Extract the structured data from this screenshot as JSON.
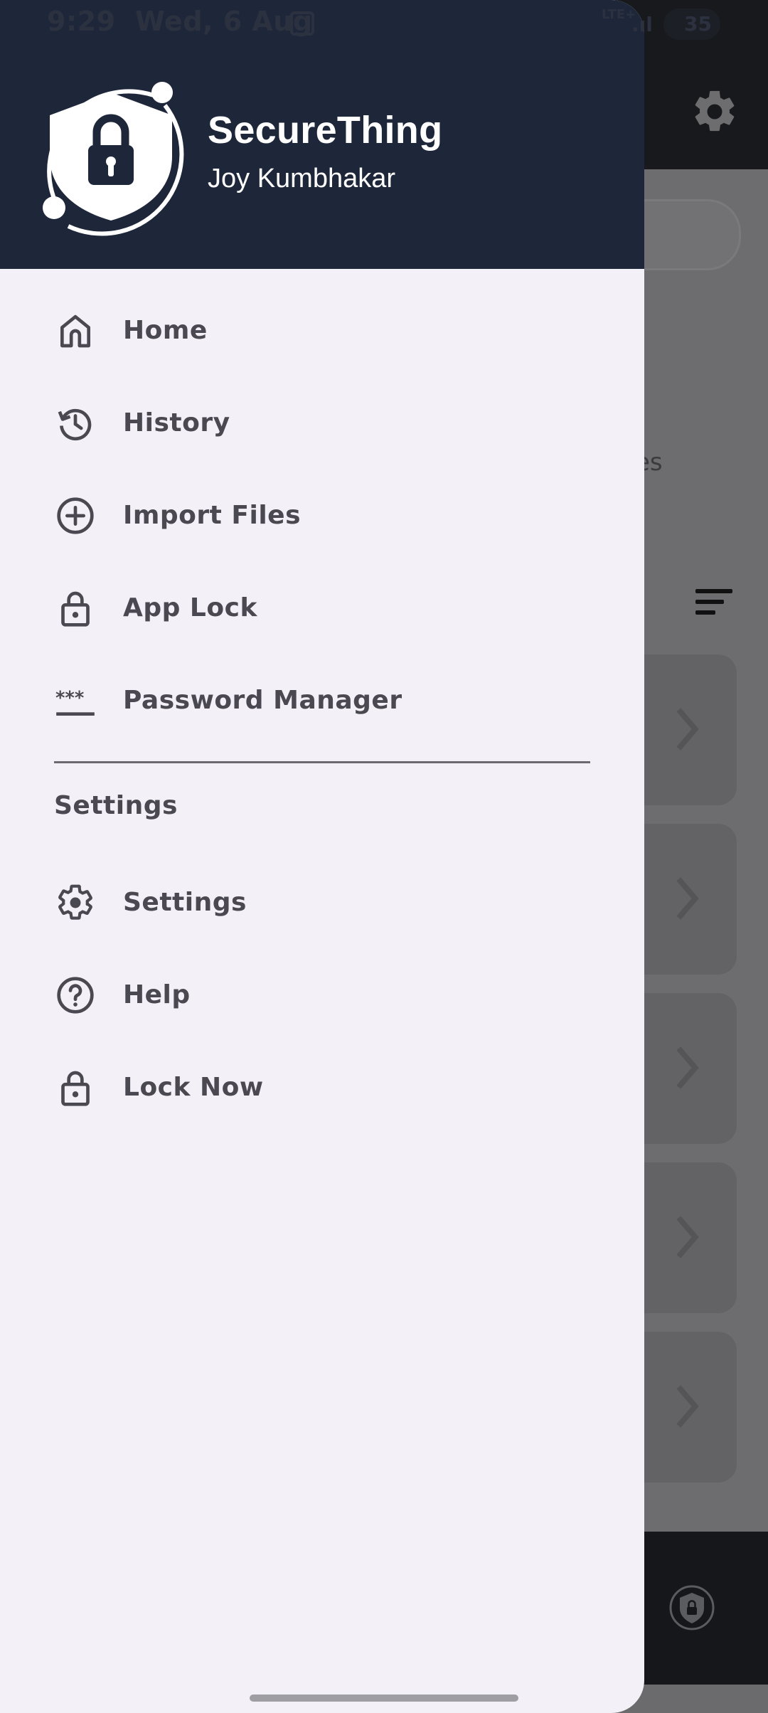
{
  "status_bar": {
    "time": "9:29",
    "date": "Wed, 6 Aug",
    "network": "LTE+",
    "battery": "35"
  },
  "drawer": {
    "header": {
      "app_name": "SecureThing",
      "user_name": "Joy Kumbhakar",
      "logo_icon": "shield-lock-icon"
    },
    "items": [
      {
        "label": "Home",
        "icon": "home-icon"
      },
      {
        "label": "History",
        "icon": "history-icon"
      },
      {
        "label": "Import Files",
        "icon": "add-circle-icon"
      },
      {
        "label": "App Lock",
        "icon": "lock-icon"
      },
      {
        "label": "Password Manager",
        "icon": "password-icon"
      }
    ],
    "section_title": "Settings",
    "settings_items": [
      {
        "label": "Settings",
        "icon": "gear-icon"
      },
      {
        "label": "Help",
        "icon": "help-icon"
      },
      {
        "label": "Lock Now",
        "icon": "lock-icon"
      }
    ]
  },
  "background": {
    "partial_text": "es"
  },
  "colors": {
    "header_bg": "#1e273a",
    "drawer_bg": "#f4f0f7",
    "menu_text": "#4a4850",
    "scrim": "#6b6b6d"
  }
}
